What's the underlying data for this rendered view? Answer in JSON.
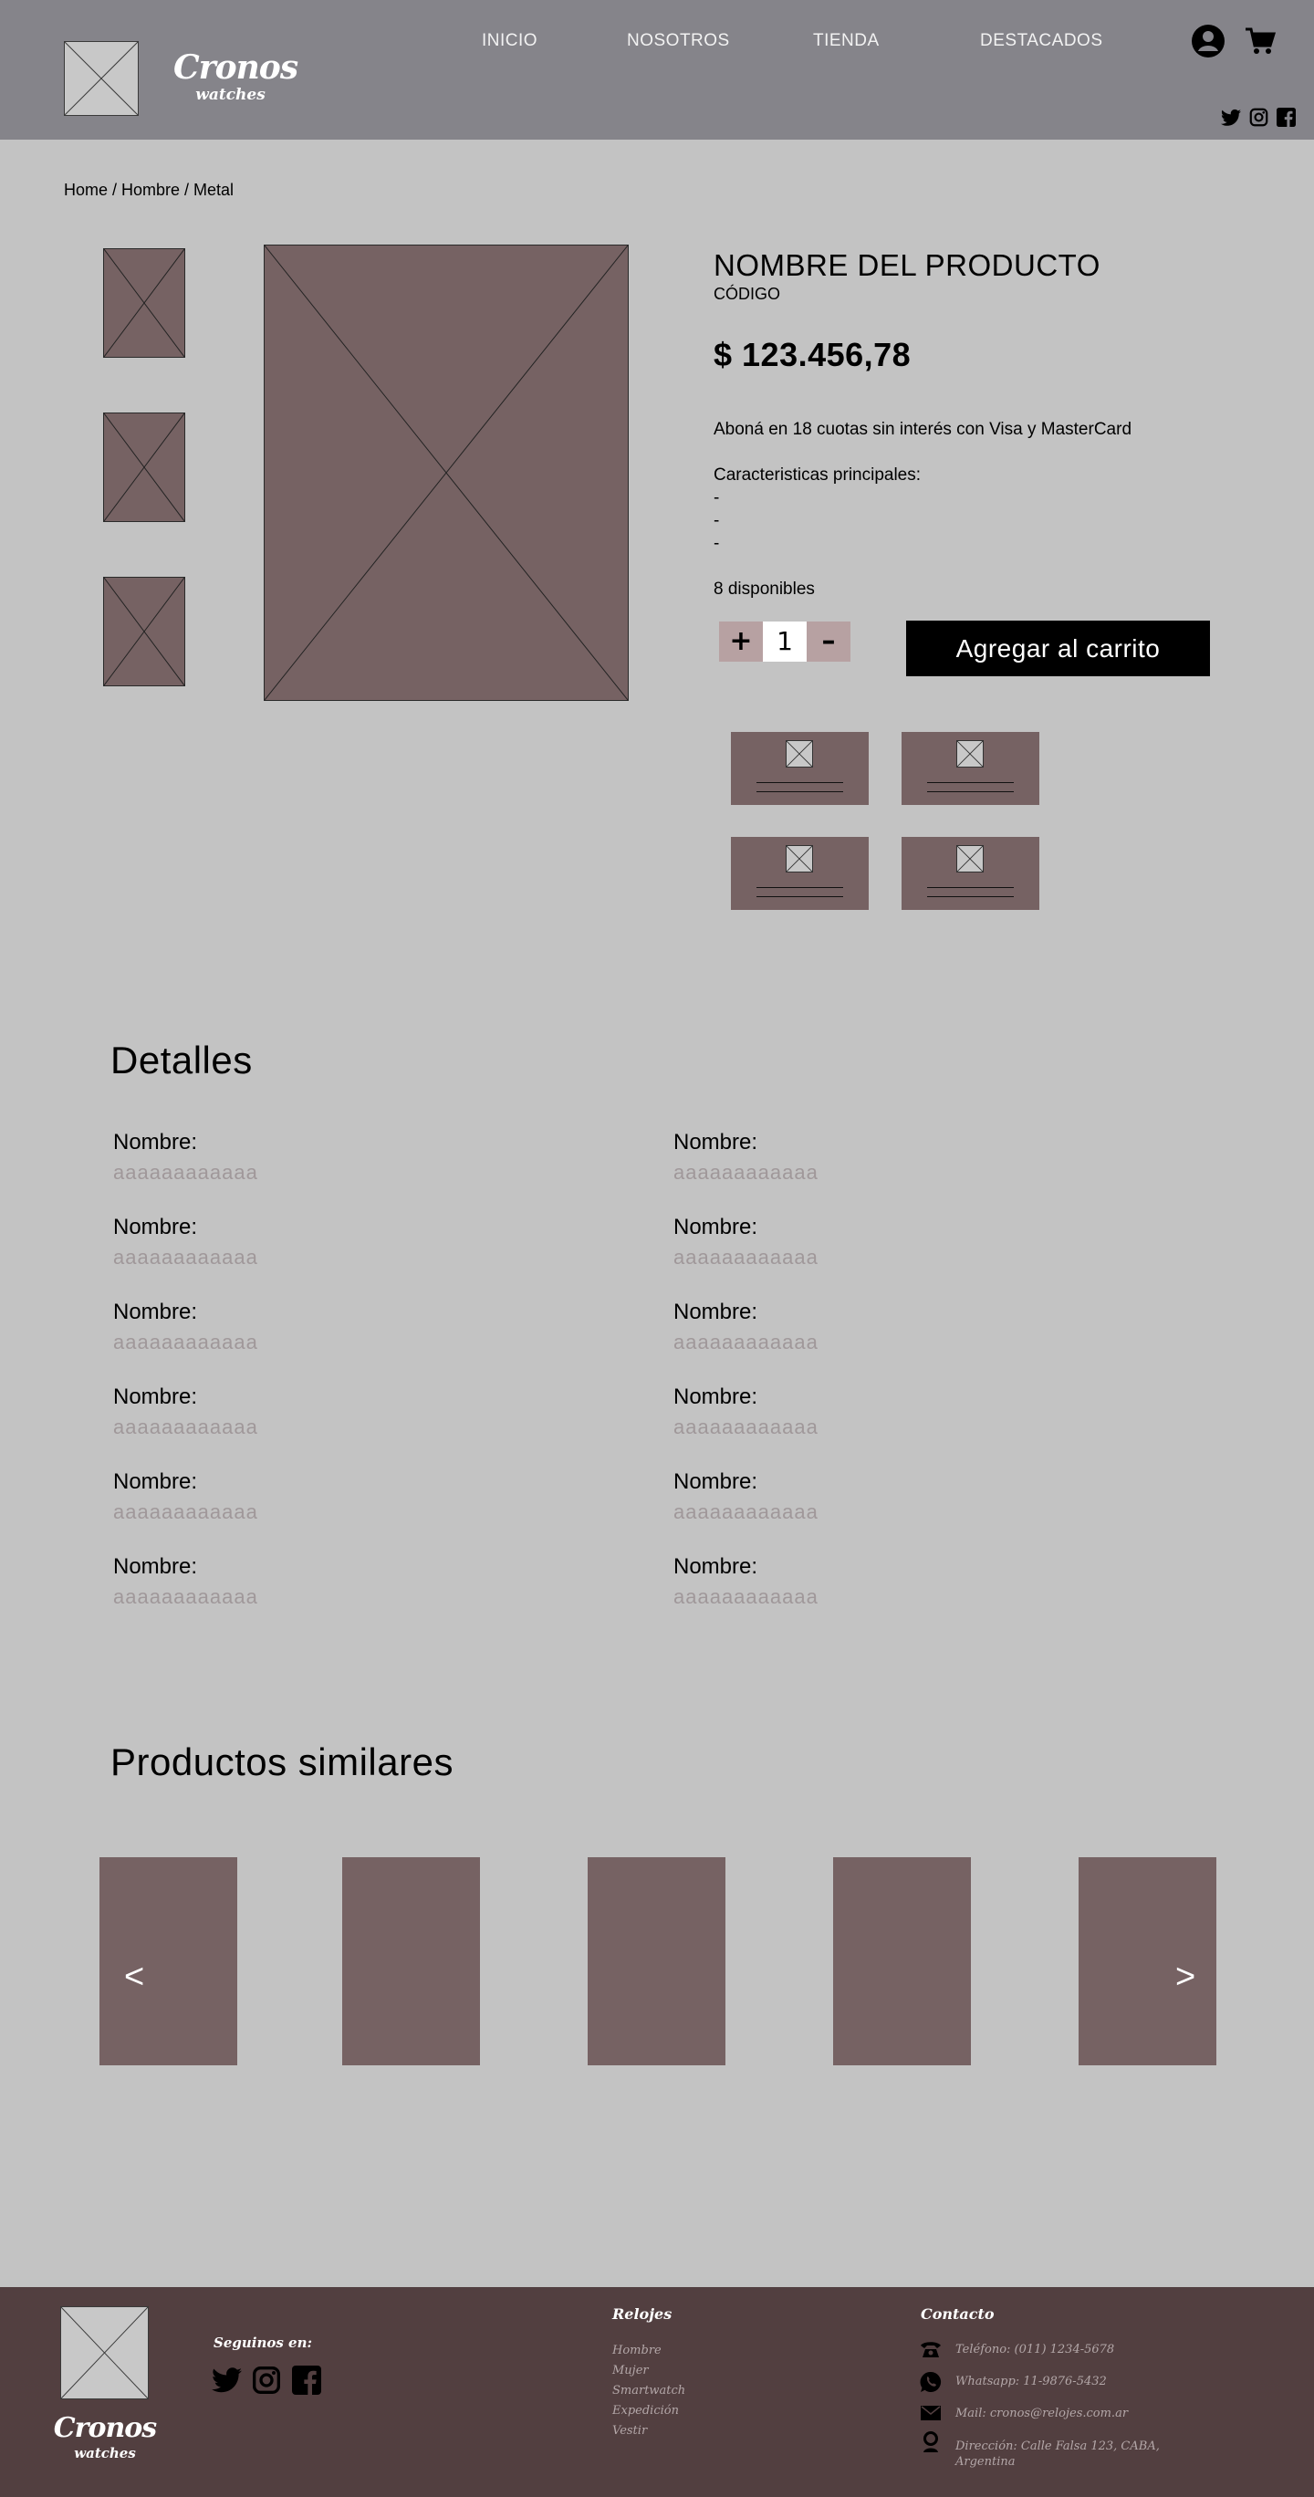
{
  "header": {
    "brand_name": "Cronos",
    "brand_sub": "watches",
    "nav": [
      "INICIO",
      "NOSOTROS",
      "TIENDA",
      "DESTACADOS"
    ]
  },
  "breadcrumb": "Home / Hombre / Metal",
  "product": {
    "title": "NOMBRE DEL PRODUCTO",
    "code": "CÓDIGO",
    "price": "$ 123.456,78",
    "installments": "Aboná en 18 cuotas sin interés con Visa y MasterCard",
    "features_title": "Caracteristicas principales:",
    "features": [
      "-",
      "-",
      "-"
    ],
    "stock": "8 disponibles",
    "qty_plus": "+",
    "qty_value": "1",
    "qty_minus": "–",
    "add_to_cart": "Agregar al carrito"
  },
  "details": {
    "title": "Detalles",
    "items": [
      {
        "label": "Nombre:",
        "value": "aaaaaaaaaaaa"
      },
      {
        "label": "Nombre:",
        "value": "aaaaaaaaaaaa"
      },
      {
        "label": "Nombre:",
        "value": "aaaaaaaaaaaa"
      },
      {
        "label": "Nombre:",
        "value": "aaaaaaaaaaaa"
      },
      {
        "label": "Nombre:",
        "value": "aaaaaaaaaaaa"
      },
      {
        "label": "Nombre:",
        "value": "aaaaaaaaaaaa"
      },
      {
        "label": "Nombre:",
        "value": "aaaaaaaaaaaa"
      },
      {
        "label": "Nombre:",
        "value": "aaaaaaaaaaaa"
      },
      {
        "label": "Nombre:",
        "value": "aaaaaaaaaaaa"
      },
      {
        "label": "Nombre:",
        "value": "aaaaaaaaaaaa"
      },
      {
        "label": "Nombre:",
        "value": "aaaaaaaaaaaa"
      },
      {
        "label": "Nombre:",
        "value": "aaaaaaaaaaaa"
      }
    ]
  },
  "similar": {
    "title": "Productos similares",
    "prev": "<",
    "next": ">"
  },
  "footer": {
    "brand_name": "Cronos",
    "brand_sub": "watches",
    "follow": "Seguinos en:",
    "relojes_title": "Relojes",
    "relojes_links": [
      "Hombre",
      "Mujer",
      "Smartwatch",
      "Expedición",
      "Vestir"
    ],
    "contact_title": "Contacto",
    "phone": "Teléfono: (011) 1234-5678",
    "whatsapp": "Whatsapp: 11-9876-5432",
    "mail": "Mail: cronos@relojes.com.ar",
    "address": "Dirección: Calle Falsa 123, CABA, Argentina"
  },
  "colors": {
    "header_bg": "#85848a",
    "page_bg": "#c3c3c3",
    "product_bg": "#766263",
    "qty_bg": "#b7a1a2",
    "footer_bg": "#523f40"
  },
  "icons": [
    "account-icon",
    "cart-icon",
    "twitter-icon",
    "instagram-icon",
    "facebook-icon",
    "phone-icon",
    "whatsapp-icon",
    "mail-icon",
    "location-icon"
  ]
}
